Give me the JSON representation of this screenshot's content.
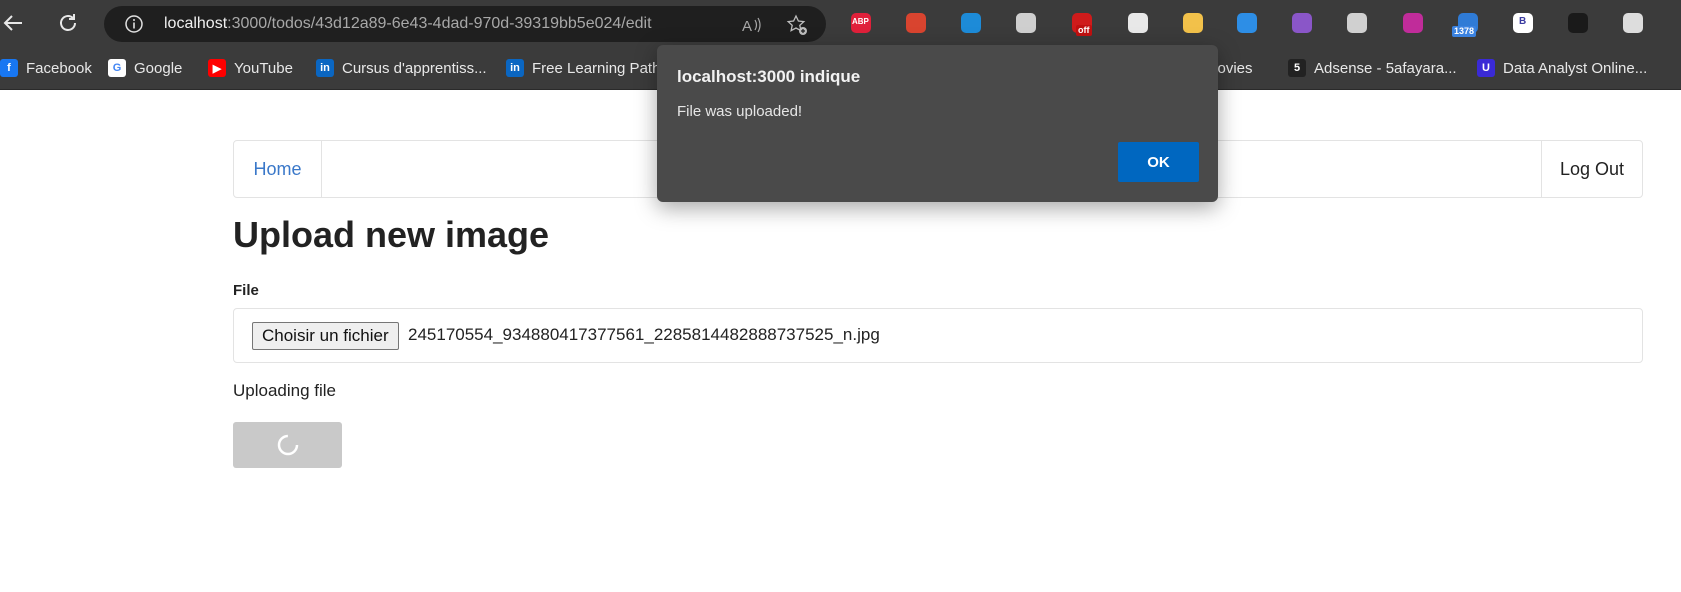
{
  "browser": {
    "address": {
      "host": "localhost",
      "rest": ":3000/todos/43d12a89-6e43-4dad-970d-39319bb5e024/edit"
    },
    "extensions": [
      {
        "name": "adblock-plus-icon",
        "badge": "ABP",
        "color": "#e0203a"
      },
      {
        "name": "paw-extension-icon",
        "badge": "",
        "color": "#d9442f"
      },
      {
        "name": "magnifier-extension-icon",
        "badge": "",
        "color": "#1d8bd8"
      },
      {
        "name": "sync-extension-icon",
        "badge": "",
        "color": "#cfcfcf"
      },
      {
        "name": "mail-extension-icon",
        "badge": "off",
        "color": "#cf1b1b"
      },
      {
        "name": "pen-extension-icon",
        "badge": "",
        "color": "#e8e8e8"
      },
      {
        "name": "notes-extension-icon",
        "badge": "",
        "color": "#f2c14a"
      },
      {
        "name": "metamask-extension-icon",
        "badge": "",
        "color": "#2d8ee6"
      },
      {
        "name": "fox-extension-icon",
        "badge": "",
        "color": "#8a56c8"
      },
      {
        "name": "target-extension-icon",
        "badge": "",
        "color": "#d0d0d0"
      },
      {
        "name": "chart-extension-icon",
        "badge": "",
        "color": "#c02c9a"
      },
      {
        "name": "graduation-extension-icon",
        "badge": "1378",
        "color": "#2f7bd6"
      },
      {
        "name": "b-extension-icon",
        "badge": "B",
        "color": "#ffffff"
      },
      {
        "name": "robot-extension-icon",
        "badge": "",
        "color": "#1a1a1a"
      },
      {
        "name": "puzzle-extensions-icon",
        "badge": "",
        "color": "#dddddd"
      }
    ],
    "bookmarks": [
      {
        "label": "Facebook",
        "color": "#1877f2",
        "glyph": "f"
      },
      {
        "label": "Google",
        "color": "#ffffff",
        "glyph": "G"
      },
      {
        "label": "YouTube",
        "color": "#ff0000",
        "glyph": "▶"
      },
      {
        "label": "Cursus d'apprentiss...",
        "color": "#0a66c2",
        "glyph": "in"
      },
      {
        "label": "Free Learning Path",
        "color": "#0a66c2",
        "glyph": "in"
      },
      {
        "label": "movies",
        "color": "",
        "glyph": ""
      },
      {
        "label": "Adsense - 5afayara...",
        "color": "#222222",
        "glyph": "5"
      },
      {
        "label": "Data Analyst Online...",
        "color": "#3a2ad6",
        "glyph": "U"
      }
    ]
  },
  "nav": {
    "home": "Home",
    "logout": "Log Out"
  },
  "page": {
    "title": "Upload new image",
    "file_label": "File",
    "file_button": "Choisir un fichier",
    "file_name": "245170554_934880417377561_2285814482888737525_n.jpg",
    "status": "Uploading file"
  },
  "dialog": {
    "title": "localhost:3000 indique",
    "message": "File was uploaded!",
    "ok": "OK"
  }
}
